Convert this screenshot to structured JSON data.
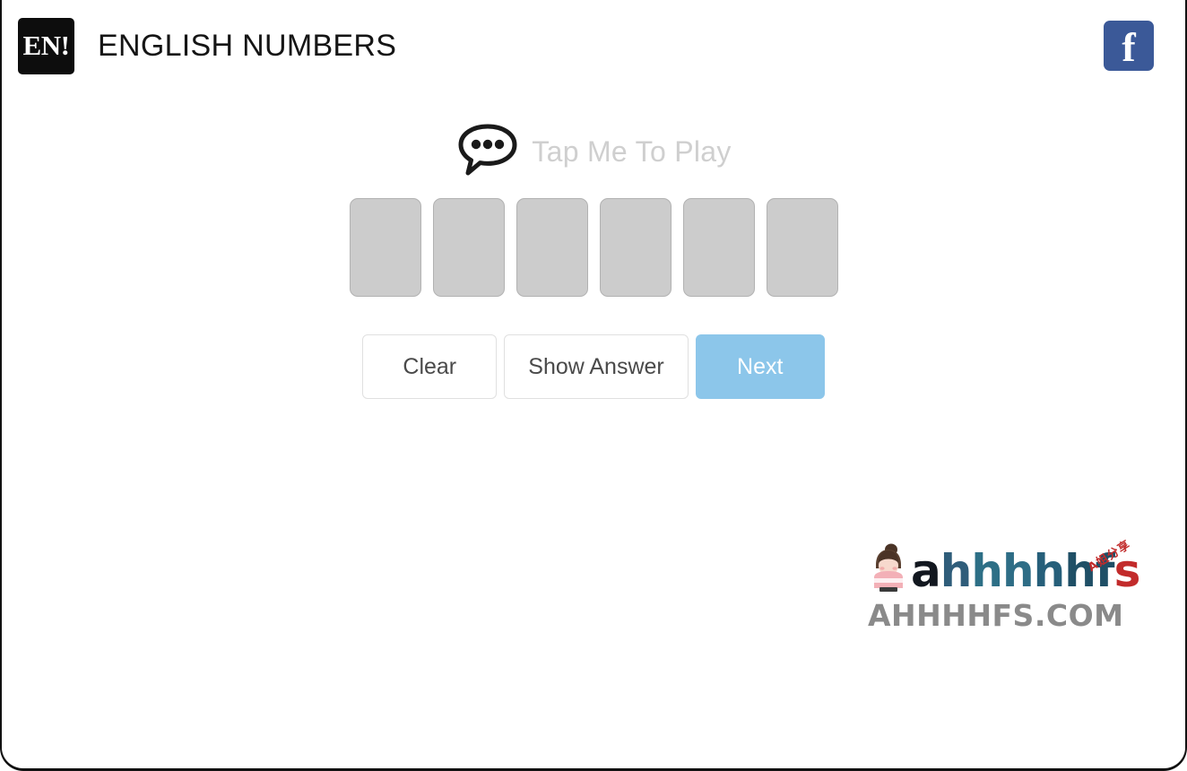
{
  "frame": {
    "accent_blue": "#8cc6ea",
    "facebook_blue": "#3b5998",
    "slot_fill": "#cccccc",
    "slot_border": "#b2b2b2"
  },
  "header": {
    "logo_text": "EN!",
    "logo_icon": "en-badge-icon",
    "title": "ENGLISH NUMBERS",
    "facebook_glyph": "f",
    "facebook_icon": "facebook-icon"
  },
  "prompt": {
    "icon": "speech-bubble-icon",
    "label": "Tap Me To Play"
  },
  "slots": {
    "count": 6,
    "values": [
      "",
      "",
      "",
      "",
      "",
      ""
    ]
  },
  "actions": {
    "clear_label": "Clear",
    "show_answer_label": "Show Answer",
    "next_label": "Next"
  },
  "watermark": {
    "avatar_icon": "girl-avatar-icon",
    "wordmark_letters": [
      "a",
      "h",
      "h",
      "h",
      "h",
      "h",
      "f",
      "s"
    ],
    "cn_tag": "A姐分享",
    "domain": "AHHHHFS.COM"
  }
}
